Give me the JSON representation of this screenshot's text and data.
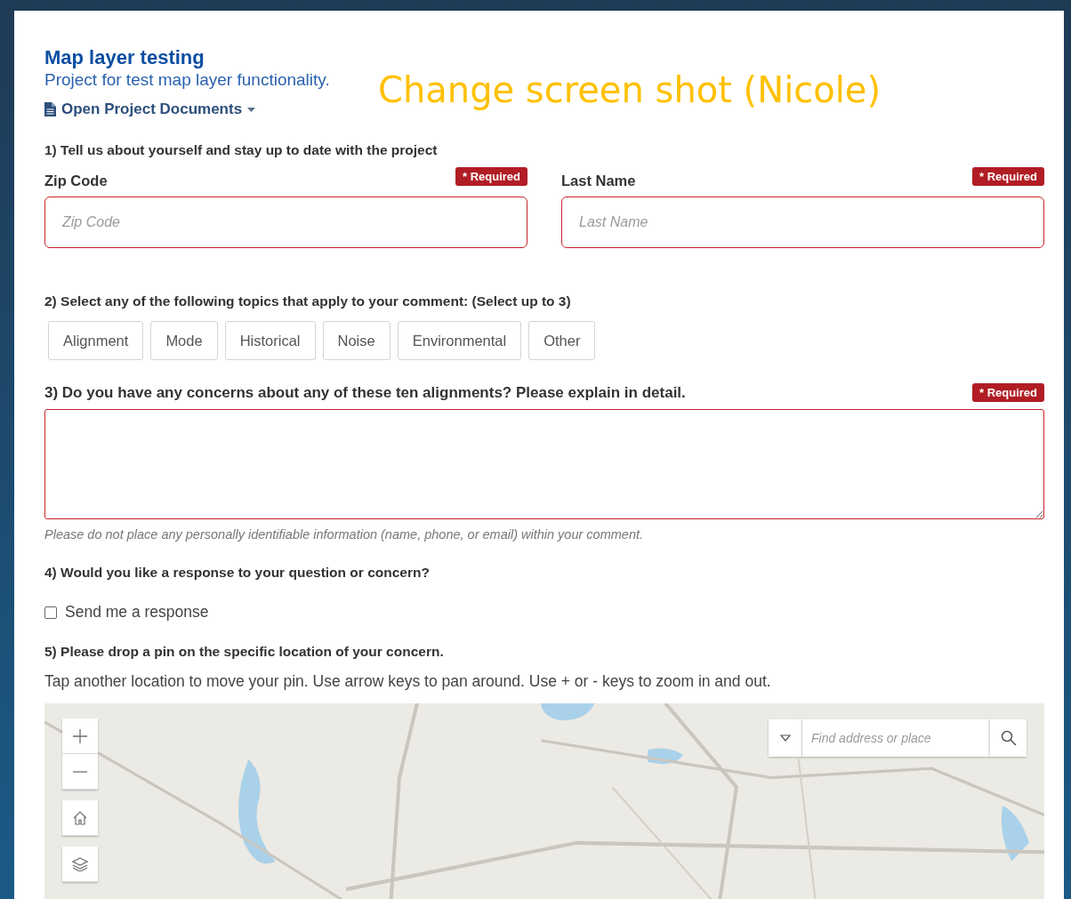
{
  "annotation": "Change screen shot (Nicole)",
  "project": {
    "title": "Map layer testing",
    "subtitle": "Project for test map layer functionality.",
    "documents_link": "Open Project Documents"
  },
  "q1": {
    "heading": "1) Tell us about yourself and stay up to date with the project",
    "fields": [
      {
        "label": "Zip Code",
        "placeholder": "Zip Code",
        "badge": "* Required"
      },
      {
        "label": "Last Name",
        "placeholder": "Last Name",
        "badge": "* Required"
      }
    ]
  },
  "q2": {
    "heading": "2) Select any of the following topics that apply to your comment: (Select up to 3)",
    "topics": [
      {
        "label": "Alignment",
        "selected": false
      },
      {
        "label": "Mode",
        "selected": false
      },
      {
        "label": "Historical",
        "selected": false
      },
      {
        "label": "Noise",
        "selected": false
      },
      {
        "label": "Environmental",
        "selected": false
      },
      {
        "label": "Other",
        "selected": false
      }
    ]
  },
  "q3": {
    "heading": "3) Do you have any concerns about any of these ten alignments? Please explain in detail.",
    "badge": "* Required",
    "hint": "Please do not place any personally identifiable information (name, phone, or email) within your comment."
  },
  "q4": {
    "heading": "4) Would you like a response to your question or concern?",
    "checkbox": {
      "label": "Send me a response",
      "checked": false
    }
  },
  "q5": {
    "heading": "5) Please drop a pin on the specific location of your concern.",
    "instructions": "Tap another location to move your pin. Use arrow keys to pan around. Use + or - keys to zoom in and out.",
    "map": {
      "kind": "picture",
      "search": {
        "placeholder": "Find address or place"
      }
    }
  }
}
